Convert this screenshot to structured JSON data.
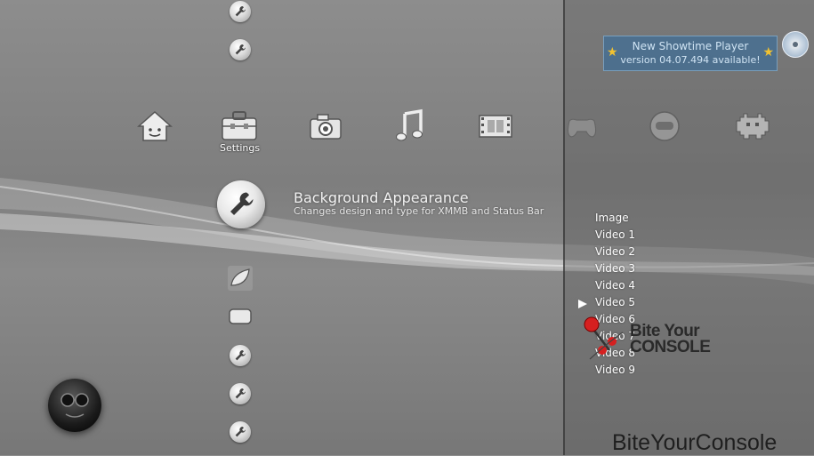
{
  "categories": [
    {
      "name": "home-icon",
      "label": ""
    },
    {
      "name": "toolbox-icon",
      "label": "Settings"
    },
    {
      "name": "camera-icon",
      "label": ""
    },
    {
      "name": "music-icon",
      "label": ""
    },
    {
      "name": "film-icon",
      "label": ""
    },
    {
      "name": "gamepad-icon",
      "label": ""
    },
    {
      "name": "friends-icon",
      "label": ""
    },
    {
      "name": "invader-icon",
      "label": ""
    }
  ],
  "selected_item": {
    "title": "Background Appearance",
    "description": "Changes design and type for XMMB and Status Bar"
  },
  "options": [
    "Image",
    "Video 1",
    "Video 2",
    "Video 3",
    "Video 4",
    "Video 5",
    "Video 6",
    "Video 7",
    "Video 8",
    "Video 9"
  ],
  "selected_option": "Video 5",
  "notification": {
    "line1": "New Showtime Player",
    "line2": "version 04.07.494 available!"
  },
  "watermark": {
    "logo_line1": "Bite Your",
    "logo_line2": "CONSOLE",
    "footer": "BiteYourConsole"
  },
  "colors": {
    "notice_bg": "#406e96",
    "star": "#f2c230",
    "text": "#ffffff"
  }
}
